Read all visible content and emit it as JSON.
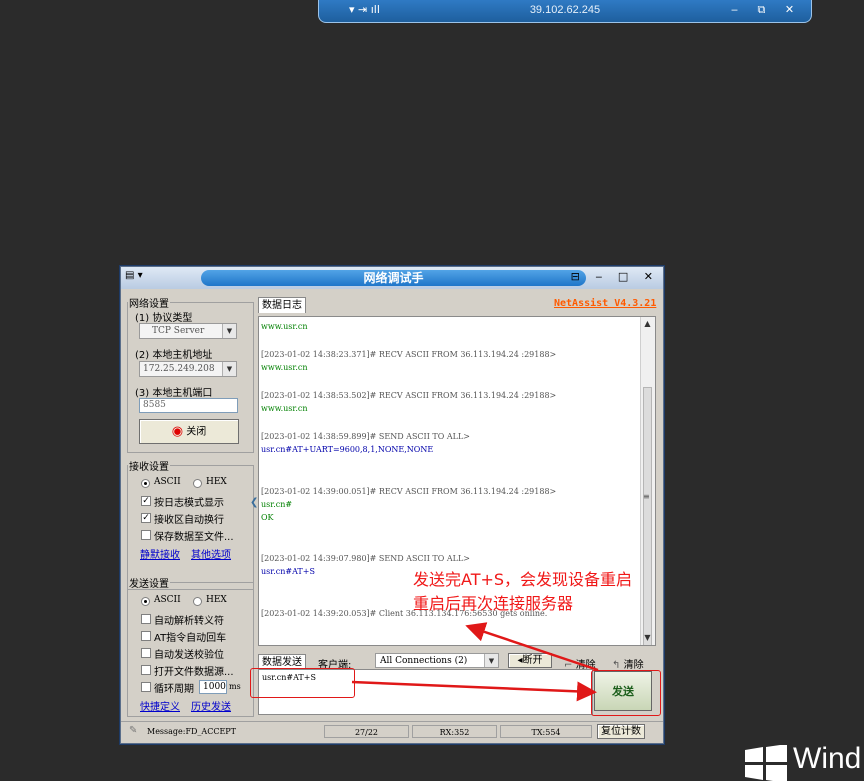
{
  "remote_bar": {
    "ip": "39.102.62.245",
    "left_icons": "▾ ⇥ ıll",
    "right_icons": "‒ ⧉ ✕"
  },
  "window": {
    "title": "网络调试手",
    "menu_icon": "▾",
    "controls": "⊟ ‒ □ ✕"
  },
  "net_settings": {
    "legend": "网络设置",
    "protocol_label": "(1) 协议类型",
    "protocol_value": "TCP Server",
    "host_label": "(2) 本地主机地址",
    "host_value": "172.25.249.208",
    "port_label": "(3) 本地主机端口",
    "port_value": "8585",
    "close_button": "关闭"
  },
  "recv_settings": {
    "legend": "接收设置",
    "ascii": "ASCII",
    "hex": "HEX",
    "log_mode": "按日志模式显示",
    "auto_wrap": "接收区自动换行",
    "save_file": "保存数据至文件...",
    "mute_link": "静默接收",
    "other_link": "其他选项"
  },
  "send_settings": {
    "legend": "发送设置",
    "ascii": "ASCII",
    "hex": "HEX",
    "auto_escape": "自动解析转义符",
    "at_enter": "AT指令自动回车",
    "auto_checksum": "自动发送校验位",
    "open_file": "打开文件数据源...",
    "loop_label": "循环周期",
    "loop_value": "1000",
    "loop_unit": "ms",
    "quick_link": "快捷定义",
    "history_link": "历史发送"
  },
  "log": {
    "tab": "数据日志",
    "brand": "NetAssist V4.3.21",
    "lines": [
      {
        "text": "www.usr.cn",
        "cls": "g"
      },
      {
        "text": "[2023-01-02 14:38:23.371]# RECV ASCII FROM 36.113.194.24 :29188>",
        "cls": "gr"
      },
      {
        "text": "www.usr.cn",
        "cls": "g"
      },
      {
        "text": "[2023-01-02 14:38:53.502]# RECV ASCII FROM 36.113.194.24 :29188>",
        "cls": "gr"
      },
      {
        "text": "www.usr.cn",
        "cls": "g"
      },
      {
        "text": "[2023-01-02 14:38:59.899]# SEND ASCII TO ALL>",
        "cls": "gr"
      },
      {
        "text": "usr.cn#AT+UART=9600,8,1,NONE,NONE",
        "cls": "b"
      },
      {
        "text": "[2023-01-02 14:39:00.051]# RECV ASCII FROM 36.113.194.24 :29188>",
        "cls": "gr"
      },
      {
        "text": "usr.cn#",
        "cls": "g"
      },
      {
        "text": "OK",
        "cls": "g"
      },
      {
        "text": "[2023-01-02 14:39:07.980]# SEND ASCII TO ALL>",
        "cls": "gr"
      },
      {
        "text": "usr.cn#AT+S",
        "cls": "b"
      },
      {
        "text": "[2023-01-02 14:39:20.053]# Client 36.113.134.176:56530 gets online.",
        "cls": "gr"
      }
    ]
  },
  "send_area": {
    "tab": "数据发送",
    "client_label": "客户端:",
    "client_value": "All Connections (2)",
    "disconnect": "断开",
    "clear1": "清除",
    "clear2": "清除",
    "input_text": "usr.cn#AT+S",
    "send_button": "发送"
  },
  "status": {
    "message": "Message:FD_ACCEPT",
    "count": "27/22",
    "rx": "RX:352",
    "tx": "TX:554",
    "reset": "复位计数"
  },
  "annotation": {
    "line1": "发送完AT+S，会发现设备重启",
    "line2": "重启后再次连接服务器",
    "color": "#f01818"
  },
  "windows_watermark": "Wind"
}
